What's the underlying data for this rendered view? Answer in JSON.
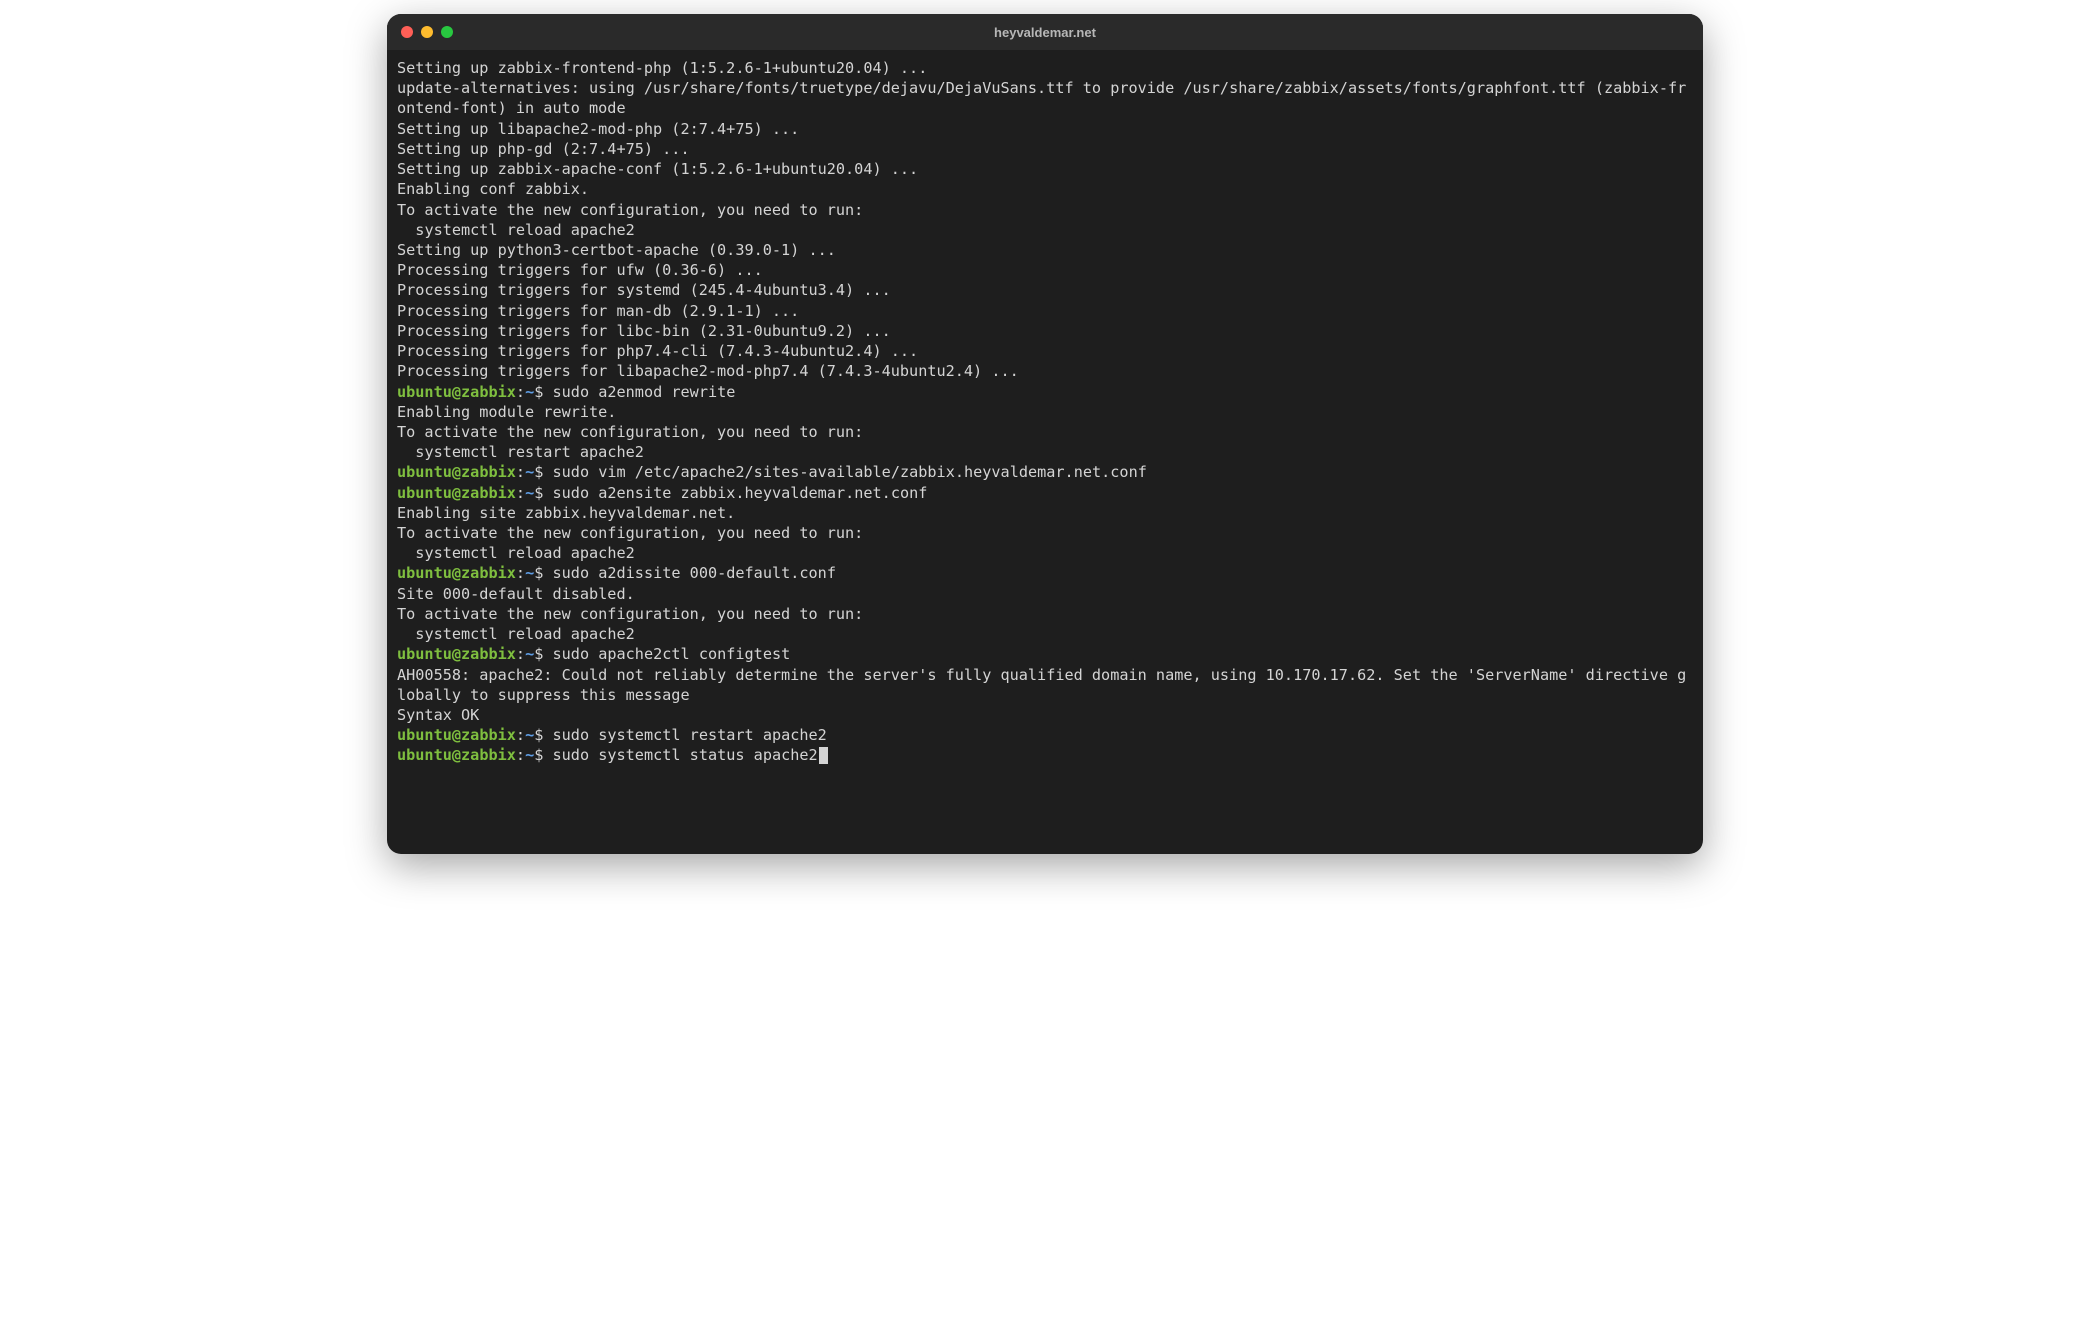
{
  "window": {
    "title": "heyvaldemar.net"
  },
  "prompt": {
    "user": "ubuntu",
    "at": "@",
    "host": "zabbix",
    "colon": ":",
    "path": "~",
    "dollar": "$ "
  },
  "lines": [
    {
      "t": "out",
      "text": "Setting up zabbix-frontend-php (1:5.2.6-1+ubuntu20.04) ..."
    },
    {
      "t": "out",
      "text": "update-alternatives: using /usr/share/fonts/truetype/dejavu/DejaVuSans.ttf to provide /usr/share/zabbix/assets/fonts/graphfont.ttf (zabbix-frontend-font) in auto mode"
    },
    {
      "t": "out",
      "text": "Setting up libapache2-mod-php (2:7.4+75) ..."
    },
    {
      "t": "out",
      "text": "Setting up php-gd (2:7.4+75) ..."
    },
    {
      "t": "out",
      "text": "Setting up zabbix-apache-conf (1:5.2.6-1+ubuntu20.04) ..."
    },
    {
      "t": "out",
      "text": "Enabling conf zabbix."
    },
    {
      "t": "out",
      "text": "To activate the new configuration, you need to run:"
    },
    {
      "t": "out",
      "text": "  systemctl reload apache2"
    },
    {
      "t": "out",
      "text": "Setting up python3-certbot-apache (0.39.0-1) ..."
    },
    {
      "t": "out",
      "text": "Processing triggers for ufw (0.36-6) ..."
    },
    {
      "t": "out",
      "text": "Processing triggers for systemd (245.4-4ubuntu3.4) ..."
    },
    {
      "t": "out",
      "text": "Processing triggers for man-db (2.9.1-1) ..."
    },
    {
      "t": "out",
      "text": "Processing triggers for libc-bin (2.31-0ubuntu9.2) ..."
    },
    {
      "t": "out",
      "text": "Processing triggers for php7.4-cli (7.4.3-4ubuntu2.4) ..."
    },
    {
      "t": "out",
      "text": "Processing triggers for libapache2-mod-php7.4 (7.4.3-4ubuntu2.4) ..."
    },
    {
      "t": "cmd",
      "text": "sudo a2enmod rewrite"
    },
    {
      "t": "out",
      "text": "Enabling module rewrite."
    },
    {
      "t": "out",
      "text": "To activate the new configuration, you need to run:"
    },
    {
      "t": "out",
      "text": "  systemctl restart apache2"
    },
    {
      "t": "cmd",
      "text": "sudo vim /etc/apache2/sites-available/zabbix.heyvaldemar.net.conf"
    },
    {
      "t": "cmd",
      "text": "sudo a2ensite zabbix.heyvaldemar.net.conf"
    },
    {
      "t": "out",
      "text": "Enabling site zabbix.heyvaldemar.net."
    },
    {
      "t": "out",
      "text": "To activate the new configuration, you need to run:"
    },
    {
      "t": "out",
      "text": "  systemctl reload apache2"
    },
    {
      "t": "cmd",
      "text": "sudo a2dissite 000-default.conf"
    },
    {
      "t": "out",
      "text": "Site 000-default disabled."
    },
    {
      "t": "out",
      "text": "To activate the new configuration, you need to run:"
    },
    {
      "t": "out",
      "text": "  systemctl reload apache2"
    },
    {
      "t": "cmd",
      "text": "sudo apache2ctl configtest"
    },
    {
      "t": "out",
      "text": "AH00558: apache2: Could not reliably determine the server's fully qualified domain name, using 10.170.17.62. Set the 'ServerName' directive globally to suppress this message"
    },
    {
      "t": "out",
      "text": "Syntax OK"
    },
    {
      "t": "cmd",
      "text": "sudo systemctl restart apache2"
    },
    {
      "t": "cmd",
      "text": "sudo systemctl status apache2",
      "cursor": true
    }
  ]
}
